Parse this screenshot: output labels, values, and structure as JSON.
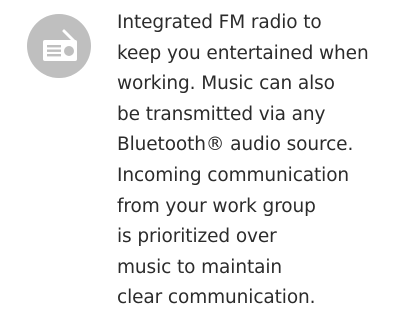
{
  "feature": {
    "icon": "radio-icon",
    "icon_color": "#bfbfbf",
    "text_color": "#2b2b2b",
    "lines": [
      "Integrated FM radio to",
      "keep you entertained when",
      "working. Music can also",
      "be transmitted via any",
      "Bluetooth® audio source.",
      "Incoming communication",
      "from your work group",
      "is prioritized over",
      "music to maintain",
      "clear communication."
    ]
  }
}
